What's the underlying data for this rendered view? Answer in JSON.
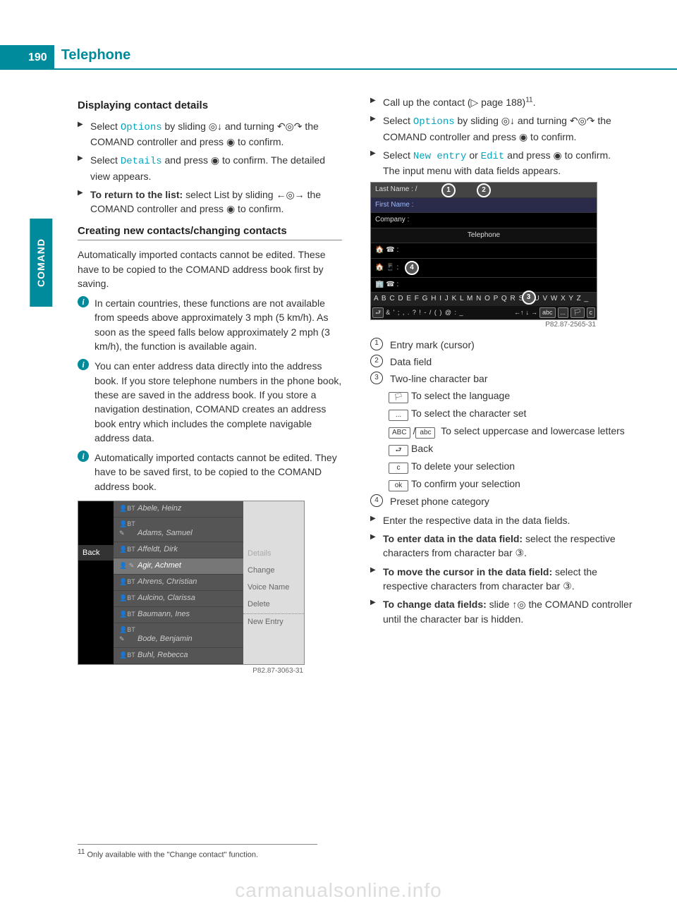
{
  "header": {
    "page_number": "190",
    "title": "Telephone"
  },
  "side_tab": "COMAND",
  "left": {
    "h1": "Displaying contact details",
    "s1a": "Select ",
    "s1_opt": "Options",
    "s1b": " by sliding ◎↓ and turning ↶◎↷ the COMAND controller and press ◉ to confirm.",
    "s2a": "Select ",
    "s2_det": "Details",
    "s2b": " and press ◉ to confirm. The detailed view appears.",
    "s3a": "To return to the list:",
    "s3b": " select List by sliding ←◎→ the COMAND controller and press ◉ to confirm.",
    "h2": "Creating new contacts/changing contacts",
    "p1": "Automatically imported contacts cannot be edited. These have to be copied to the COMAND address book first by saving.",
    "i1": "In certain countries, these functions are not available from speeds above approximately 3 mph (5 km/h). As soon as the speed falls below approximately 2 mph (3 km/h), the function is available again.",
    "i2": "You can enter address data directly into the address book. If you store telephone numbers in the phone book, these are saved in the address book. If you store a navigation destination, COMAND creates an address book entry which includes the complete navigable address data.",
    "i3": "Automatically imported contacts cannot be edited. They have to be saved first, to be copied to the COMAND address book.",
    "contacts": [
      "Abele, Heinz",
      "Adams, Samuel",
      "Affeldt, Dirk",
      "Agir, Achmet",
      "Ahrens, Christian",
      "Aulcino, Clarissa",
      "Baumann, Ines",
      "Bode, Benjamin",
      "Buhl, Rebecca"
    ],
    "back_label": "Back",
    "menu": {
      "details": "Details",
      "change": "Change",
      "voice": "Voice Name",
      "delete": "Delete",
      "new": "New Entry"
    },
    "fig1_caption": "P82.87-3063-31"
  },
  "right": {
    "s1a": "Call up the contact (▷ page 188)",
    "s1sup": "11",
    "s1b": ".",
    "s2a": "Select ",
    "s2_opt": "Options",
    "s2b": " by sliding ◎↓ and turning ↶◎↷ the COMAND controller and press ◉ to confirm.",
    "s3a": "Select ",
    "s3_new": "New entry",
    "s3_or": " or ",
    "s3_edit": "Edit",
    "s3b": " and press ◉ to confirm.",
    "s3c": "The input menu with data fields appears.",
    "entry": {
      "lastname": "Last Name : /",
      "firstname": "First Name :",
      "company": "Company :",
      "telephone": "Telephone",
      "char_row1": "A B C D E F G H I J K L M N O P Q R S T U V W X Y Z _",
      "char_row2_left": "& ' ; , . ? ! - / ( ) @ : _",
      "abc": "abc",
      "dots": "...",
      "c": "c"
    },
    "fig2_caption": "P82.87-2565-31",
    "legend": {
      "l1": "Entry mark (cursor)",
      "l2": "Data field",
      "l3": "Two-line character bar",
      "l3a": "To select the language",
      "l3b": "To select the character set",
      "l3c": "To select uppercase and lowercase letters",
      "l3d": "Back",
      "l3e": "To delete your selection",
      "l3f": "To confirm your selection",
      "l4": "Preset phone category"
    },
    "s4": "Enter the respective data in the data fields.",
    "s5a": "To enter data in the data field:",
    "s5b": " select the respective characters from character bar ③.",
    "s6a": "To move the cursor in the data field:",
    "s6b": " select the respective characters from character bar ③.",
    "s7a": "To change data fields: ",
    "s7b": " slide ↑◎ the COMAND controller until the character bar is hidden."
  },
  "footnote": {
    "num": "11",
    "text": " Only available with the \"Change contact\" function."
  },
  "watermark": "carmanualsonline.info"
}
